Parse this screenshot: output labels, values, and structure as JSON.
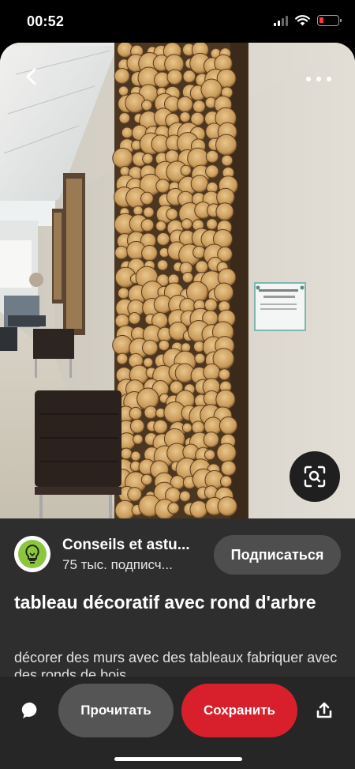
{
  "status_bar": {
    "time": "00:52",
    "battery_color": "#ff3b30"
  },
  "nav": {
    "back_icon": "chevron-left-icon",
    "more_icon": "more-horizontal-icon"
  },
  "image": {
    "subject": "rustic wood-slice wall art",
    "lens_icon": "visual-search-icon"
  },
  "creator": {
    "name": "Conseils et astu...",
    "followers": "75 тыс. подписч...",
    "avatar_icon": "lightbulb-icon",
    "avatar_color": "#8cc63f"
  },
  "follow_button": {
    "label": "Подписаться"
  },
  "pin": {
    "title": "tableau décoratif avec rond d'arbre",
    "description": "décorer des murs avec des tableaux fabriquer avec des ronds de bois"
  },
  "actions": {
    "comment_icon": "comment-bubble-icon",
    "read_label": "Прочитать",
    "save_label": "Сохранить",
    "save_color": "#d8202c",
    "share_icon": "share-icon"
  }
}
